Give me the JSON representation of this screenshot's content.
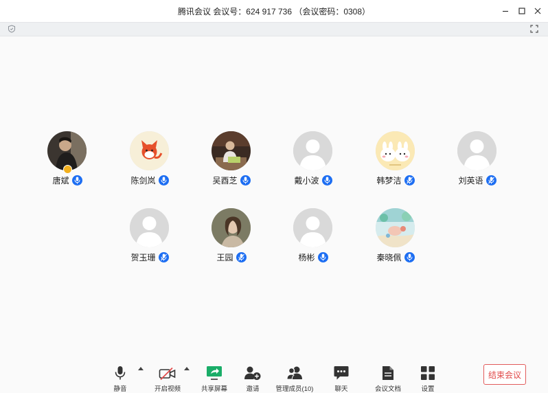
{
  "window": {
    "title": "腾讯会议 会议号：624 917 736 （会议密码：0308）"
  },
  "participants": [
    {
      "name": "唐斌",
      "avatar": "photo-dark",
      "host": true,
      "mic": "on"
    },
    {
      "name": "陈剑岚",
      "avatar": "cartoon-fox",
      "host": false,
      "mic": "on"
    },
    {
      "name": "吴酉芝",
      "avatar": "photo-man",
      "host": false,
      "mic": "on"
    },
    {
      "name": "戴小波",
      "avatar": "default",
      "host": false,
      "mic": "on"
    },
    {
      "name": "韩梦洁",
      "avatar": "cartoon-bunnies",
      "host": false,
      "mic": "muted"
    },
    {
      "name": "刘英语",
      "avatar": "default",
      "host": false,
      "mic": "muted"
    },
    {
      "name": "贺玉珊",
      "avatar": "default",
      "host": false,
      "mic": "muted"
    },
    {
      "name": "王园",
      "avatar": "photo-painting",
      "host": false,
      "mic": "muted"
    },
    {
      "name": "杨彬",
      "avatar": "default",
      "host": false,
      "mic": "on"
    },
    {
      "name": "秦晓佩",
      "avatar": "photo-cartoon-scene",
      "host": false,
      "mic": "on"
    }
  ],
  "toolbar": {
    "mute": "静音",
    "video": "开启视频",
    "share": "共享屏幕",
    "invite": "邀请",
    "members": "管理成员(10)",
    "chat": "聊天",
    "docs": "会议文档",
    "settings": "设置",
    "end": "结束会议"
  },
  "colors": {
    "accent": "#1d6ef2",
    "end_button": "#e04848",
    "share_green": "#1aad68",
    "video_off_red": "#e24a4a",
    "host_badge": "#f2b01e"
  }
}
